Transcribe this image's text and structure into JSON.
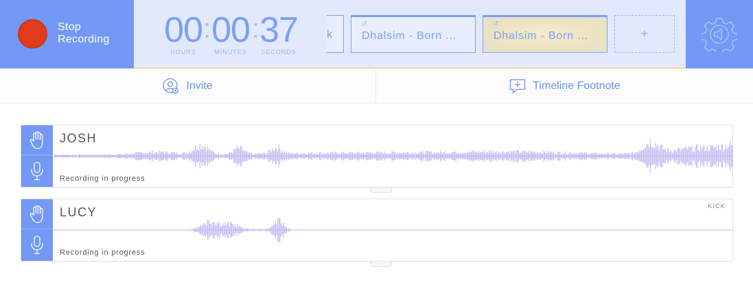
{
  "recorder": {
    "stop_label": "Stop Recording"
  },
  "timer": {
    "hours": "00",
    "minutes": "00",
    "seconds": "37",
    "hours_label": "HOURS",
    "minutes_label": "MINUTES",
    "seconds_label": "SECONDS"
  },
  "sound_tiles": [
    {
      "label": "k"
    },
    {
      "label": "Dhalsim - Born ..."
    },
    {
      "label": "Dhalsim - Born ..."
    },
    {
      "label": "+"
    }
  ],
  "actions": {
    "invite_label": "Invite",
    "footnote_label": "Timeline Footnote"
  },
  "tracks": [
    {
      "name": "JOSH",
      "status": "Recording in progress",
      "tag": ""
    },
    {
      "name": "LUCY",
      "status": "Recording in progress",
      "tag": "KICK"
    }
  ],
  "colors": {
    "accent": "#7398f5",
    "record": "#e23b1c",
    "timer": "#7aa0f5",
    "wave": "#bcaef0",
    "bar_bg": "#e3e9fc",
    "highlight_tile": "#ede3c0"
  },
  "icons": {
    "settings": "gear-speaker-icon",
    "invite": "add-user-icon",
    "footnote": "comment-plus-icon",
    "hand": "hand-icon",
    "mic": "microphone-icon",
    "loop": "loop-icon"
  }
}
